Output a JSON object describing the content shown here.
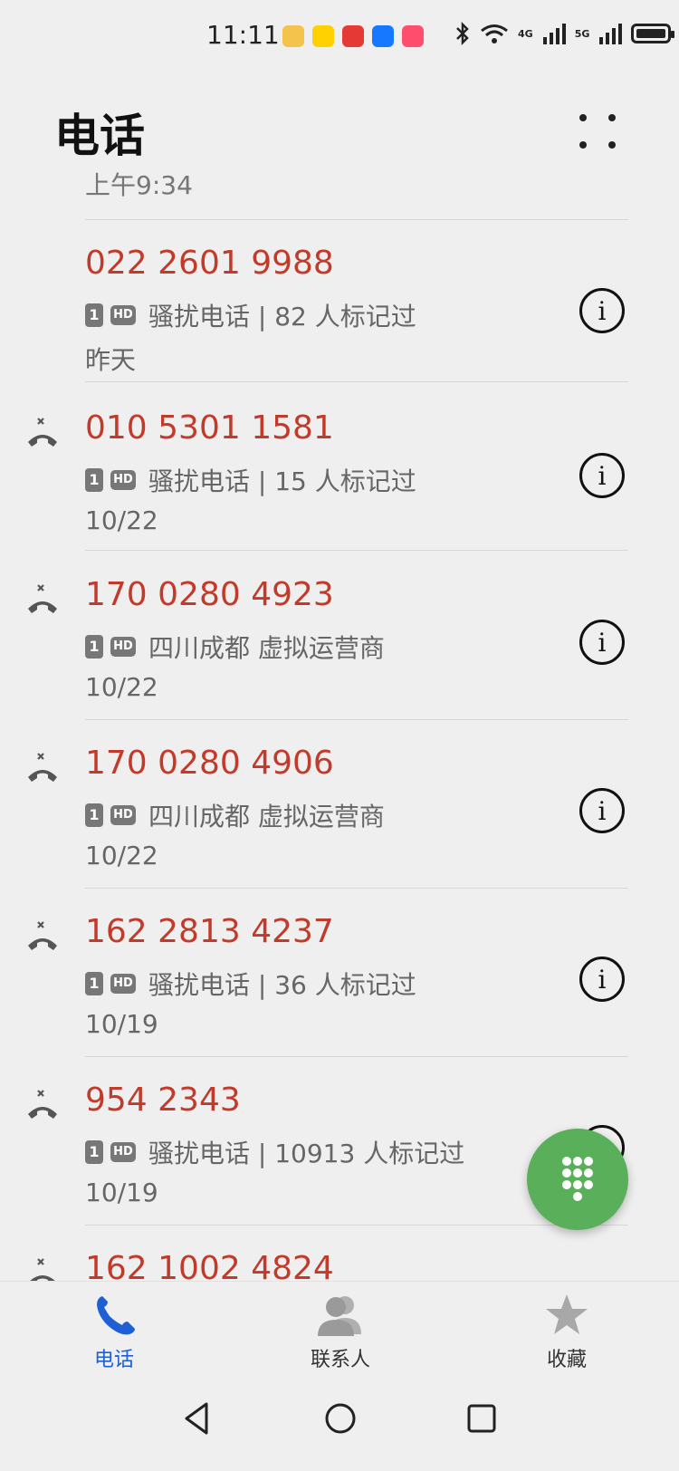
{
  "status": {
    "time": "11:11",
    "net_4g": "4G",
    "net_5g": "5G"
  },
  "header": {
    "title": "电话"
  },
  "clipped_prev_text": "上午9:34",
  "calls": [
    {
      "number": "022 2601 9988",
      "sim": "1",
      "hd": "HD",
      "desc": "骚扰电话 | 82 人标记过",
      "date": "昨天",
      "missed": false
    },
    {
      "number": "010 5301 1581",
      "sim": "1",
      "hd": "HD",
      "desc": "骚扰电话 | 15 人标记过",
      "date": "10/22",
      "missed": true
    },
    {
      "number": "170 0280 4923",
      "sim": "1",
      "hd": "HD",
      "desc": "四川成都 虚拟运营商",
      "date": "10/22",
      "missed": true
    },
    {
      "number": "170 0280 4906",
      "sim": "1",
      "hd": "HD",
      "desc": "四川成都 虚拟运营商",
      "date": "10/22",
      "missed": true
    },
    {
      "number": "162 2813 4237",
      "sim": "1",
      "hd": "HD",
      "desc": "骚扰电话 | 36 人标记过",
      "date": "10/19",
      "missed": true
    },
    {
      "number": "954 2343",
      "sim": "1",
      "hd": "HD",
      "desc": "骚扰电话 | 10913 人标记过",
      "date": "10/19",
      "missed": true
    },
    {
      "number": "162 1002 4824",
      "sim": "1",
      "hd": "HD",
      "desc": "",
      "date": "",
      "missed": true
    }
  ],
  "nav": {
    "phone": "电话",
    "contacts": "联系人",
    "favorites": "收藏"
  },
  "colors": {
    "missed_number": "#c23b2a",
    "active_tab": "#1f5fd6",
    "fab": "#5ab05a"
  },
  "icons": {
    "missed": "missed-call-icon",
    "info": "info-icon",
    "dialpad": "dialpad-icon",
    "phone": "phone-icon",
    "contacts": "contacts-icon",
    "favorites": "star-icon"
  }
}
